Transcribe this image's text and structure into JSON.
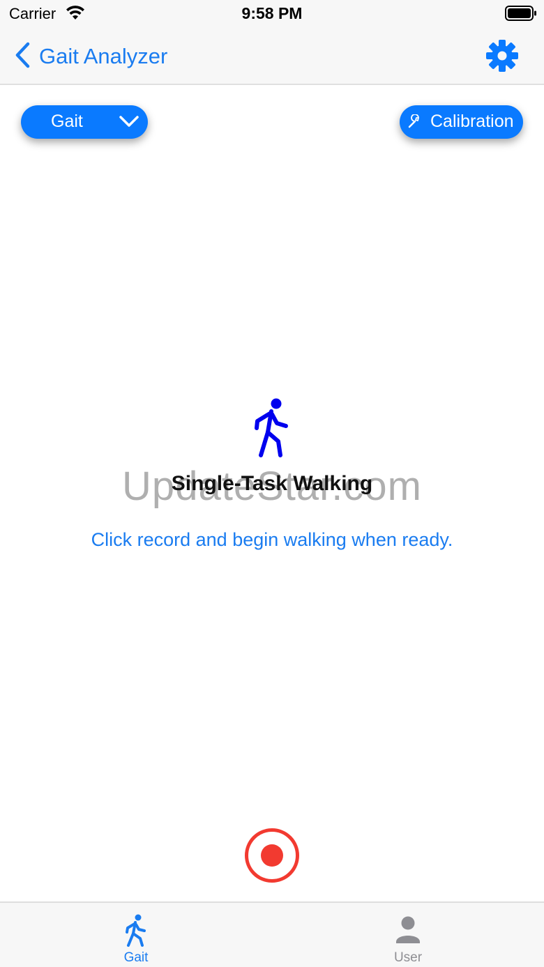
{
  "status_bar": {
    "carrier": "Carrier",
    "time": "9:58 PM",
    "wifi_icon": "wifi-icon",
    "battery_icon": "battery-icon"
  },
  "nav": {
    "back_label": "Gait Analyzer",
    "back_icon": "chevron-left-icon",
    "settings_icon": "gear-icon"
  },
  "mode_select": {
    "value": "Gait",
    "icon": "chevron-down-icon"
  },
  "calibration": {
    "label": "Calibration",
    "icon": "wrench-icon"
  },
  "main": {
    "icon": "walking-person-icon",
    "title": "Single-Task Walking",
    "instruction": "Click record and begin walking when ready."
  },
  "watermark": "UpdateStar.com",
  "record": {
    "icon": "record-icon"
  },
  "tabs": [
    {
      "label": "Gait",
      "icon": "walking-person-icon",
      "selected": true
    },
    {
      "label": "User",
      "icon": "person-icon",
      "selected": false
    }
  ],
  "colors": {
    "accent": "#0a7aff",
    "link_text": "#1a7cf0",
    "record": "#f23a30",
    "walker_icon": "#0000ee",
    "inactive_tab": "#8e8e93",
    "bar_background": "#f7f7f7"
  }
}
